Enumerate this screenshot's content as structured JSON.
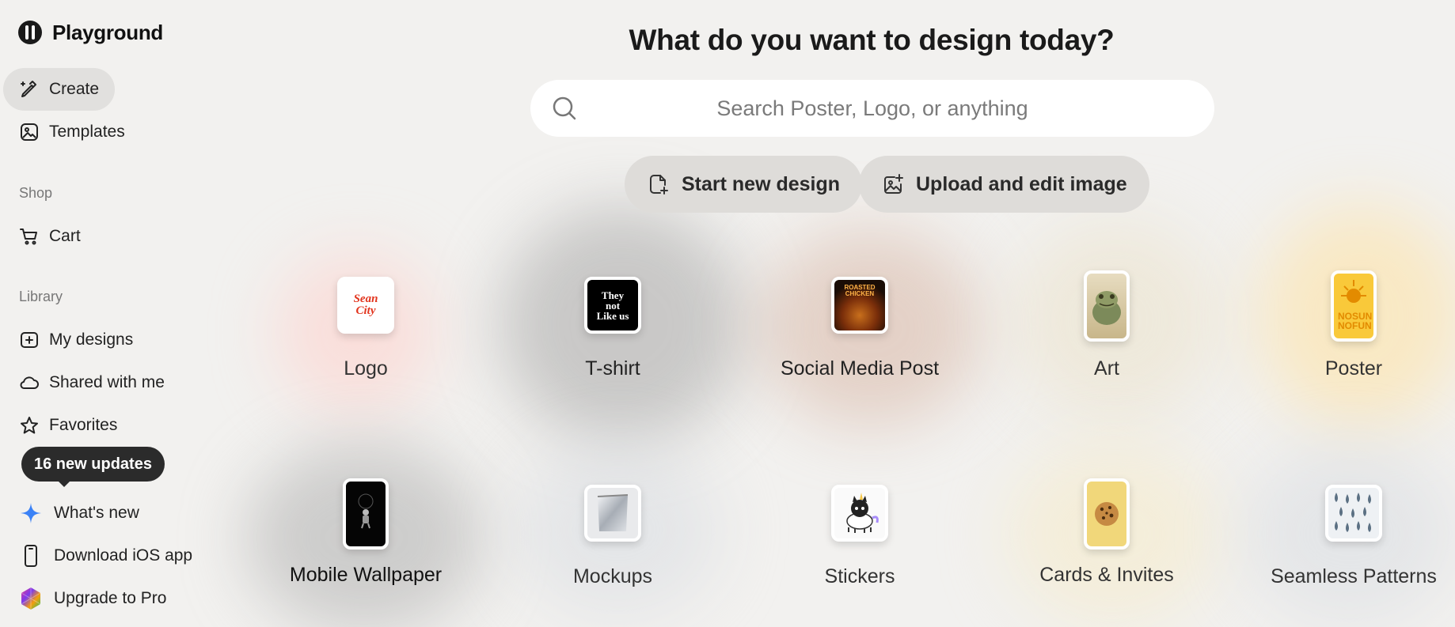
{
  "brand": {
    "name": "Playground"
  },
  "sidebar": {
    "create": "Create",
    "templates": "Templates",
    "shop_label": "Shop",
    "cart": "Cart",
    "library_label": "Library",
    "my_designs": "My designs",
    "shared": "Shared with me",
    "favorites": "Favorites",
    "updates_badge": "16 new updates",
    "whats_new": "What's new",
    "download_ios": "Download iOS app",
    "upgrade": "Upgrade to Pro"
  },
  "main": {
    "headline": "What do you want to design today?",
    "search_placeholder": "Search Poster, Logo, or anything",
    "start_new_design": "Start new design",
    "upload_edit": "Upload and edit image"
  },
  "categories": [
    {
      "label": "Logo",
      "thumb_text": "Sean City"
    },
    {
      "label": "T-shirt",
      "thumb_text": "They not Like us"
    },
    {
      "label": "Social Media Post",
      "thumb_text": "ROASTED CHICKEN"
    },
    {
      "label": "Art"
    },
    {
      "label": "Poster",
      "thumb_text": "NOSUN NOFUN"
    },
    {
      "label": "Mobile Wallpaper"
    },
    {
      "label": "Mockups"
    },
    {
      "label": "Stickers"
    },
    {
      "label": "Cards & Invites"
    },
    {
      "label": "Seamless Patterns"
    }
  ],
  "colors": {
    "background": "#f2f1ef",
    "active_nav": "#e1e0de",
    "pill": "#dedcd9",
    "tooltip": "#2b2b2b",
    "sparkle": "#3b82f6"
  }
}
